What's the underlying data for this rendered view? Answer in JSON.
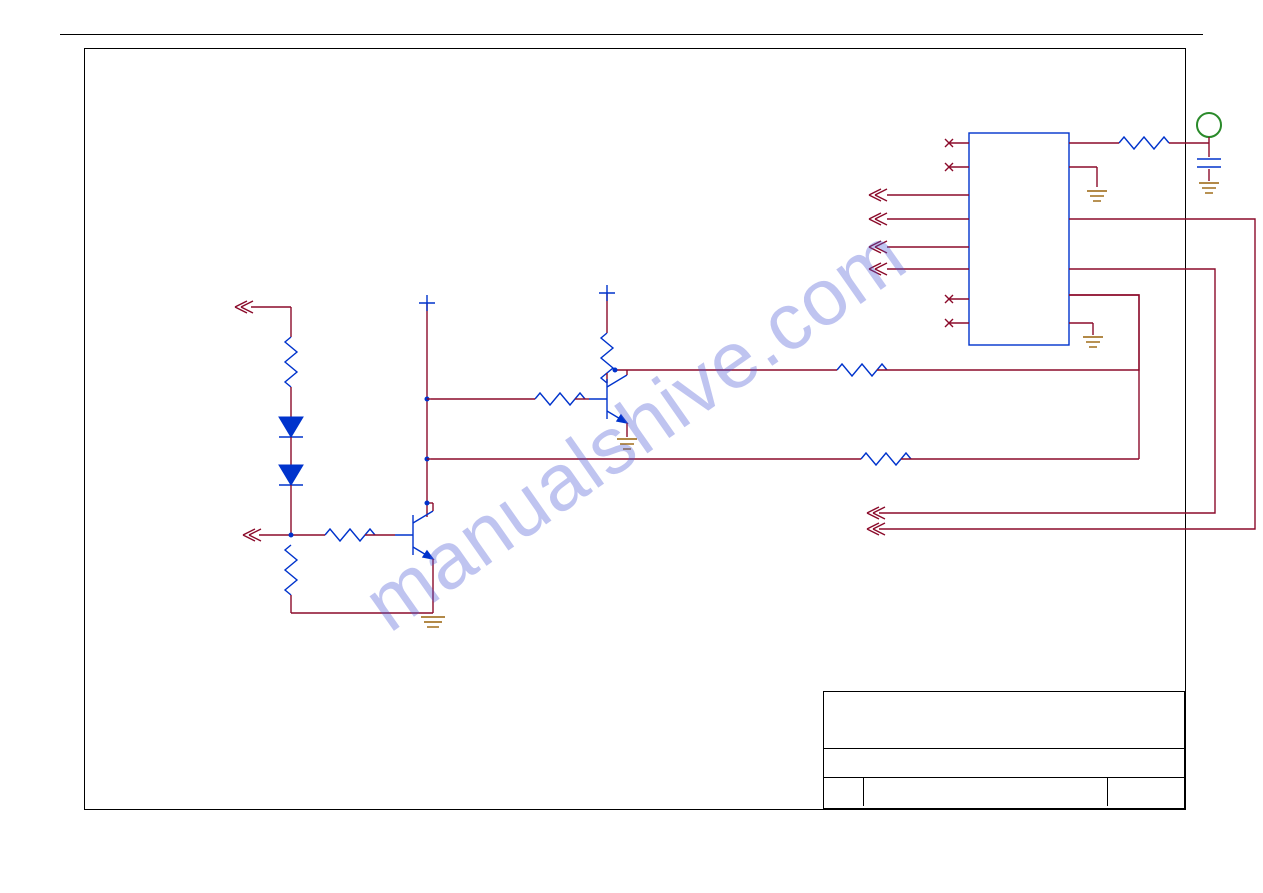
{
  "watermark": "manualshive.com",
  "schematic": {
    "ic": {
      "pins_left": [
        {
          "index": 1,
          "state": "nc"
        },
        {
          "index": 2,
          "state": "nc"
        },
        {
          "index": 3,
          "state": "port-in"
        },
        {
          "index": 4,
          "state": "port-in"
        },
        {
          "index": 5,
          "state": "port-in"
        },
        {
          "index": 6,
          "state": "port-in"
        },
        {
          "index": 7,
          "state": "nc"
        },
        {
          "index": 8,
          "state": "nc"
        }
      ],
      "pins_right": [
        {
          "index": 1,
          "net": "r-top -> pad/cap"
        },
        {
          "index": 2,
          "net": "gnd"
        },
        {
          "index": 3,
          "net": "bus-1 out"
        },
        {
          "index": 4,
          "net": "bus-2 out"
        },
        {
          "index": 5,
          "net": "bus-3 in"
        },
        {
          "index": 6,
          "net": "gnd"
        }
      ]
    },
    "components": {
      "resistors": [
        "resistor-right-top",
        "resistor-inline-top",
        "resistor-inline-bottom",
        "resistor-q2-collector",
        "resistor-q2-base",
        "resistor-left-top",
        "resistor-q1-base",
        "resistor-q1-pulldown"
      ],
      "capacitors": [
        "capacitor-right"
      ],
      "diodes": [
        "diode-1",
        "diode-2"
      ],
      "transistors": [
        "transistor-q1",
        "transistor-q2"
      ],
      "test_pads": [
        "test-pad-icon"
      ],
      "grounds": [
        "gnd-cap",
        "ic-right-gnd1",
        "ic-right-gnd2",
        "gnd-q1",
        "gnd-q2"
      ],
      "supply_symbols": [
        "plus-symbol-1",
        "plus-symbol-2"
      ]
    },
    "offpage_ports": [
      "offpage-top-left",
      "offpage-q1-base",
      "ic-left-ports",
      "offpage-bottom-right"
    ]
  },
  "title_block": {
    "rows": 3
  }
}
